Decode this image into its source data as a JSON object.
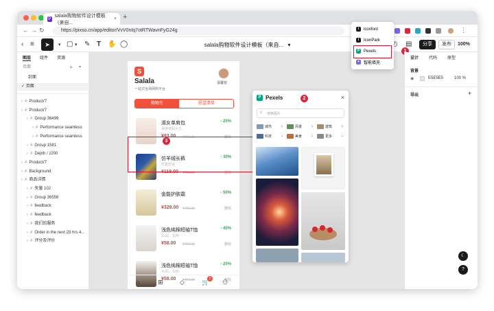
{
  "browser": {
    "tab_title": "salala购物软件设计模板（来自...",
    "tab_close": "×",
    "new_tab": "+",
    "url": "https://pixso.cn/app/editor/VvV0nIq7otRTWavnFyG24g"
  },
  "toolbar": {
    "doc_title": "salala购物软件设计模板（来自...",
    "share_label": "分享",
    "publish_label": "发布",
    "zoom": "100%"
  },
  "left_panel": {
    "tabs": [
      "图层",
      "组件",
      "资源"
    ],
    "pages_label": "页面",
    "pages": [
      "封面",
      "页面"
    ],
    "layers": [
      {
        "label": "Product/7",
        "indent": 0
      },
      {
        "label": "Product/7",
        "indent": 0
      },
      {
        "label": "Group 36499",
        "indent": 1
      },
      {
        "label": "Performance seamless",
        "indent": 2
      },
      {
        "label": "Performance seamless",
        "indent": 2
      },
      {
        "label": "Group 1581",
        "indent": 1
      },
      {
        "label": "Depth / z200",
        "indent": 1
      },
      {
        "label": "Product/7",
        "indent": 0
      },
      {
        "label": "Background",
        "indent": 0
      },
      {
        "label": "商品详情",
        "indent": 0
      },
      {
        "label": "矢量 102",
        "indent": 1
      },
      {
        "label": "Group 36556",
        "indent": 1
      },
      {
        "label": "feedback",
        "indent": 1
      },
      {
        "label": "feedback",
        "indent": 1
      },
      {
        "label": "我们的服务",
        "indent": 1
      },
      {
        "label": "Order in the next 23 hrs 4...",
        "indent": 1
      },
      {
        "label": "评分及评价",
        "indent": 1
      }
    ]
  },
  "phone": {
    "brand": "Salala",
    "slogan": "一站式全场网购平台",
    "user": "温馨窗",
    "tab_cart": "购物车",
    "tab_wish": "愿望清单",
    "products": [
      {
        "name": "淑女单肩包",
        "sub": "保持搭配大方...",
        "price": "¥93.00",
        "old": "¥460.00",
        "disc": "- 20%",
        "del": "删除"
      },
      {
        "name": "仿羊绒长裤",
        "sub": "优雅舒适",
        "price": "¥118.00",
        "old": "¥460.00",
        "disc": "- 30%",
        "del": "删除"
      },
      {
        "name": "金能护肤霜",
        "sub": "",
        "price": "¥328.00",
        "old": "¥460.00",
        "disc": "- 50%",
        "del": "删除"
      },
      {
        "name": "浅色纯棉短袖T恤",
        "sub": "XL码、白色",
        "price": "¥58.00",
        "old": "¥460.00",
        "disc": "- 40%",
        "del": "删除"
      },
      {
        "name": "浅色纯棉短袖T恤",
        "sub": "XL码、白色",
        "price": "¥58.00",
        "old": "¥460.00",
        "disc": "- 20%",
        "del": "删除"
      }
    ],
    "cart_count": "2"
  },
  "pexels": {
    "title": "Pexels",
    "close": "×",
    "search_placeholder": "搜索图片",
    "chips": [
      "城市",
      "风景",
      "建筑",
      "科技",
      "美食",
      "更多"
    ]
  },
  "plugin_menu": {
    "items": [
      {
        "label": "iconfont",
        "color": "#1a1a1a"
      },
      {
        "label": "IconPark",
        "color": "#1a1a1a"
      },
      {
        "label": "Pexels",
        "color": "#05a081"
      },
      {
        "label": "智能填充",
        "color": "#7b61ff"
      }
    ]
  },
  "right_panel": {
    "tabs": [
      "设计",
      "代码",
      "原型"
    ],
    "bg_label": "背景",
    "bg_hex": "E5E5E5",
    "bg_opacity": "100 %",
    "export_label": "导出",
    "export_add": "+"
  },
  "annotations": [
    "1",
    "2",
    "3"
  ]
}
